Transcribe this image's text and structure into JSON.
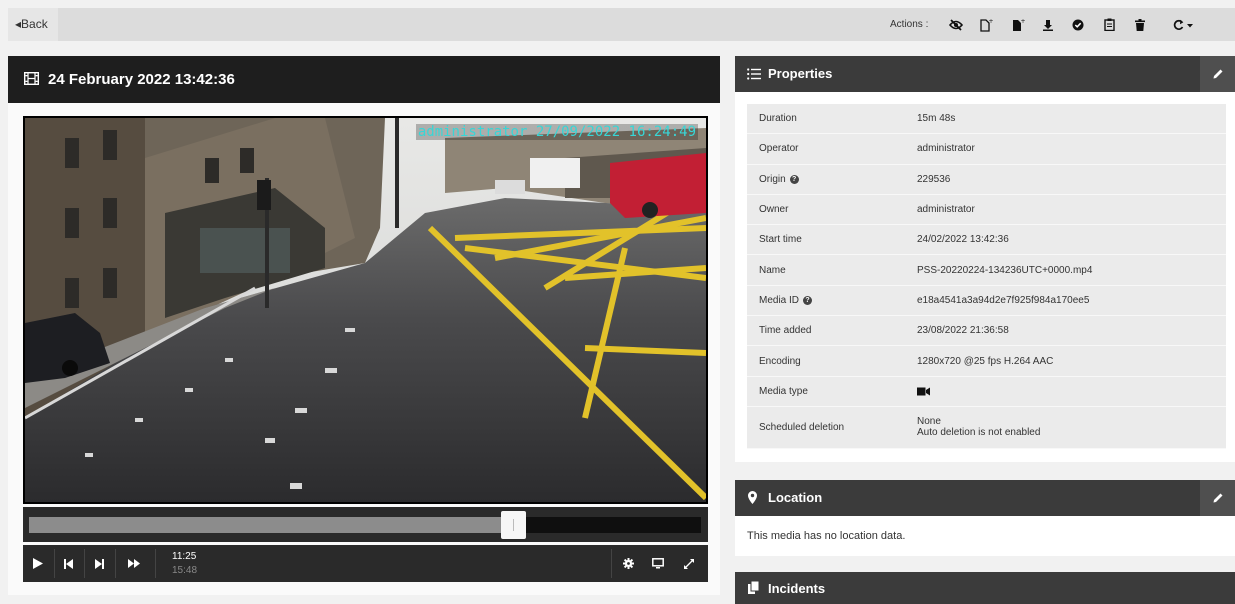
{
  "toolbar": {
    "back_label": "◂Back",
    "actions_label": "Actions :"
  },
  "media": {
    "title": "24 February 2022 13:42:36",
    "overlay_text": "administrator 27/09/2022 16:24:49",
    "playback": {
      "current_time": "11:25",
      "total_time": "15:48",
      "progress": 0.72
    }
  },
  "properties": {
    "title": "Properties",
    "rows": [
      {
        "key": "Duration",
        "value": "15m 48s"
      },
      {
        "key": "Operator",
        "value": "administrator"
      },
      {
        "key": "Origin",
        "value": "229536"
      },
      {
        "key": "Owner",
        "value": "administrator"
      },
      {
        "key": "Start time",
        "value": "24/02/2022 13:42:36"
      },
      {
        "key": "Name",
        "value": "PSS-20220224-134236UTC+0000.mp4"
      },
      {
        "key": "Media ID",
        "value": "e18a4541a3a94d2e7f925f984a170ee5"
      },
      {
        "key": "Time added",
        "value": "23/08/2022 21:36:58"
      },
      {
        "key": "Encoding",
        "value": "1280x720 @25 fps H.264 AAC"
      },
      {
        "key": "Media type",
        "value": ""
      },
      {
        "key": "Scheduled deletion",
        "value": "None",
        "value2": "Auto deletion is not enabled"
      }
    ]
  },
  "location": {
    "title": "Location",
    "message": "This media has no location data."
  },
  "incidents": {
    "title": "Incidents"
  },
  "colors": {
    "header_dark": "#1e1e1e",
    "panel_header": "#3b3b3b",
    "overlay_text": "#38d6d6"
  }
}
